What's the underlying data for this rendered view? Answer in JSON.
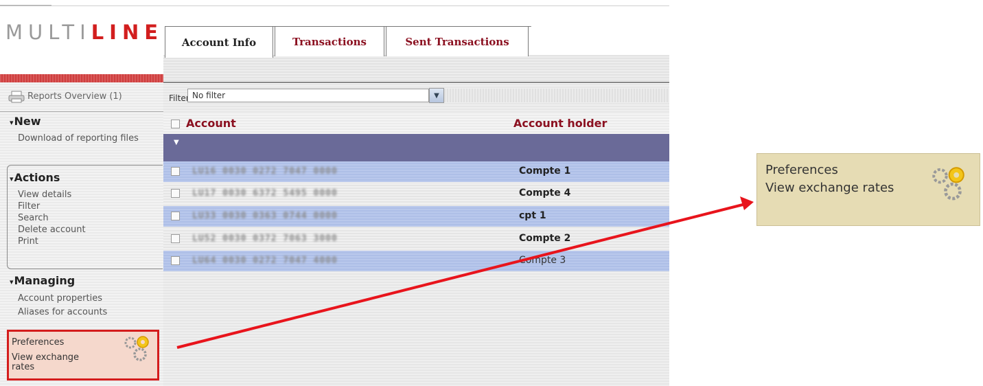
{
  "logo": {
    "prefix": "MULTI",
    "highlight": "LINE"
  },
  "tabs": [
    {
      "label": "Account Info",
      "active": true
    },
    {
      "label": "Transactions",
      "active": false
    },
    {
      "label": "Sent Transactions",
      "active": false
    }
  ],
  "sidebar": {
    "reports_label": "Reports Overview (1)",
    "new": {
      "title": "New",
      "items": [
        "Download of reporting files"
      ]
    },
    "actions": {
      "title": "Actions",
      "items": [
        "View details",
        "Filter",
        "Search",
        "Delete account",
        "Print"
      ]
    },
    "managing": {
      "title": "Managing",
      "items": [
        "Account properties",
        "Aliases for accounts"
      ]
    },
    "preferences": {
      "item1": "Preferences",
      "item2": "View exchange rates"
    }
  },
  "filter": {
    "label": "Filter",
    "value": "No filter"
  },
  "table": {
    "columns": [
      "Account",
      "Account holder"
    ],
    "rows": [
      {
        "account": "LU16 0030 0272 7047 0000",
        "holder": "Compte 1"
      },
      {
        "account": "LU17 0030 6372 5495 0000",
        "holder": "Compte 4"
      },
      {
        "account": "LU33 0030 0363 0744 0000",
        "holder": "cpt 1"
      },
      {
        "account": "LU52 0030 0372 7063 3000",
        "holder": "Compte 2"
      },
      {
        "account": "LU64 0030 0272 7047 4000",
        "holder": "Compte 3"
      }
    ]
  },
  "callout": {
    "item1": "Preferences",
    "item2": "View exchange rates"
  },
  "colors": {
    "accent": "#d21e1e",
    "tab_text": "#8b1020",
    "group_row": "#6a6a98",
    "arrow": "#e8141c"
  }
}
